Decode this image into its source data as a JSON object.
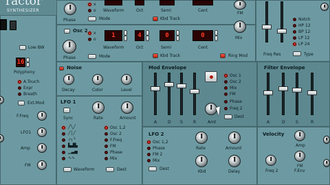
{
  "brand": {
    "title": "ractor",
    "subtitle": "SYNTHESIZER"
  },
  "osc1": {
    "labels": {
      "phase": "Phase",
      "waveform": "Waveform",
      "oct": "Oct",
      "semi": "Semi",
      "cent": "Cent",
      "mode": "Mode",
      "kbd_track": "Kbd Track",
      "fm": "FM"
    },
    "lcds": {
      "wave": "",
      "oct": "",
      "semi": "",
      "cent": ""
    }
  },
  "osc2": {
    "name": "Osc 2",
    "labels": {
      "phase": "Phase",
      "waveform": "Waveform",
      "oct": "Oct",
      "semi": "Semi",
      "cent": "Cent",
      "mode": "Mode",
      "kbd_track": "Kbd Track",
      "mix": "Mix",
      "ring_mod": "Ring Mod"
    },
    "lcds": {
      "wave": "1",
      "oct": "4",
      "semi": "0",
      "cent": "0"
    }
  },
  "filter_top": {
    "labels": {
      "freq_res": "Freq Res",
      "type": "Type"
    },
    "types": [
      "Notch",
      "HP 12",
      "BP 12",
      "LP 12",
      "LP 24"
    ]
  },
  "left": {
    "low_bw": "Low BW",
    "polyphony_lcd": "16",
    "polyphony": "Polyphony",
    "mod_sources": [
      "A.Touch",
      "Expr",
      "Breath"
    ],
    "ext_mod": "Ext.Mod",
    "dests": [
      "F.Freq",
      "LFO1",
      "Amp",
      "FM"
    ]
  },
  "noise": {
    "title": "Noise",
    "labels": [
      "Decay",
      "Color",
      "Level"
    ]
  },
  "lfo1": {
    "title": "LFO 1",
    "sync": "Sync",
    "rate": "Rate",
    "amount": "Amount",
    "waveform": "Waveform",
    "dest": "Dest",
    "dests": [
      "Osc 1,2",
      "Osc 2",
      "F.Freq",
      "FM",
      "Phase",
      "Mix"
    ]
  },
  "mod_env": {
    "title": "Mod Envelope",
    "adsr": [
      "A",
      "D",
      "S",
      "R"
    ],
    "amt": "Amt",
    "dest": "Dest",
    "dests": [
      "Osc 1",
      "Osc 2",
      "Mix",
      "FM",
      "Phase",
      "Freq 2"
    ]
  },
  "filter_env": {
    "title": "Filter Envelope",
    "adsr": [
      "A",
      "D",
      "S",
      "R"
    ]
  },
  "lfo2": {
    "title": "LFO 2",
    "dests": [
      "Osc 1,2",
      "Phase",
      "FM 2",
      "Mix"
    ],
    "dest": "Dest",
    "rate": "Rate",
    "amount": "Amount",
    "kbd": "Kbd",
    "delay": "Delay"
  },
  "velocity": {
    "title": "Velocity",
    "labels": [
      "Amp",
      "FM",
      "Freq 2",
      "F.Env"
    ]
  }
}
